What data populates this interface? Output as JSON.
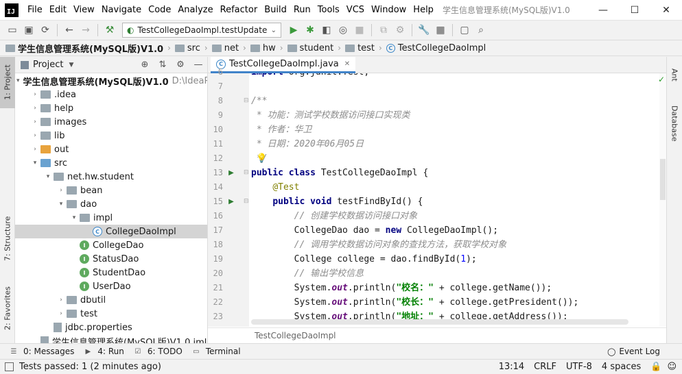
{
  "app": {
    "logo_text": "IJ",
    "window_title": "学生信息管理系统(MySQL版)V1.0"
  },
  "menu": [
    "File",
    "Edit",
    "View",
    "Navigate",
    "Code",
    "Analyze",
    "Refactor",
    "Build",
    "Run",
    "Tools",
    "VCS",
    "Window",
    "Help"
  ],
  "window_controls": {
    "minimize": "—",
    "maximize": "☐",
    "close": "✕"
  },
  "toolbar": {
    "run_config": "TestCollegeDaoImpl.testUpdate"
  },
  "breadcrumb": [
    "学生信息管理系统(MySQL版)V1.0",
    "src",
    "net",
    "hw",
    "student",
    "test",
    "TestCollegeDaoImpl"
  ],
  "left_stripe": {
    "project": "1: Project",
    "structure": "7: Structure",
    "favorites": "2: Favorites"
  },
  "right_stripe": {
    "ant": "Ant",
    "database": "Database"
  },
  "project_panel": {
    "title": "Project",
    "tree": [
      {
        "label": "学生信息管理系统(MySQL版)V1.0",
        "hint": "D:\\IdeaP",
        "icon": "folder-blue",
        "depth": 0,
        "expand": "open",
        "bold": true
      },
      {
        "label": ".idea",
        "icon": "folder",
        "depth": 1,
        "expand": "closed"
      },
      {
        "label": "help",
        "icon": "folder",
        "depth": 1,
        "expand": "closed"
      },
      {
        "label": "images",
        "icon": "folder",
        "depth": 1,
        "expand": "closed"
      },
      {
        "label": "lib",
        "icon": "folder",
        "depth": 1,
        "expand": "closed"
      },
      {
        "label": "out",
        "icon": "folder-orange",
        "depth": 1,
        "expand": "closed"
      },
      {
        "label": "src",
        "icon": "folder-blue",
        "depth": 1,
        "expand": "open"
      },
      {
        "label": "net.hw.student",
        "icon": "package",
        "depth": 2,
        "expand": "open"
      },
      {
        "label": "bean",
        "icon": "package",
        "depth": 3,
        "expand": "closed"
      },
      {
        "label": "dao",
        "icon": "package",
        "depth": 3,
        "expand": "open"
      },
      {
        "label": "impl",
        "icon": "package",
        "depth": 4,
        "expand": "open"
      },
      {
        "label": "CollegeDaoImpl",
        "icon": "class",
        "depth": 5,
        "expand": "none",
        "selected": true
      },
      {
        "label": "CollegeDao",
        "icon": "interface",
        "depth": 4,
        "expand": "none"
      },
      {
        "label": "StatusDao",
        "icon": "interface",
        "depth": 4,
        "expand": "none"
      },
      {
        "label": "StudentDao",
        "icon": "interface",
        "depth": 4,
        "expand": "none"
      },
      {
        "label": "UserDao",
        "icon": "interface",
        "depth": 4,
        "expand": "none"
      },
      {
        "label": "dbutil",
        "icon": "package",
        "depth": 3,
        "expand": "closed"
      },
      {
        "label": "test",
        "icon": "package",
        "depth": 3,
        "expand": "closed"
      },
      {
        "label": "jdbc.properties",
        "icon": "file",
        "depth": 2,
        "expand": "none"
      },
      {
        "label": "学生信息管理系统(MySQL版)V1.0.iml",
        "icon": "file",
        "depth": 1,
        "expand": "none"
      }
    ]
  },
  "editor": {
    "tab": "TestCollegeDaoImpl.java",
    "footer_breadcrumb": "TestCollegeDaoImpl",
    "lines": [
      {
        "n": "6",
        "tokens": [
          [
            "kw",
            "import"
          ],
          [
            "",
            " org.junit.Test;"
          ]
        ]
      },
      {
        "n": "7",
        "tokens": []
      },
      {
        "n": "8",
        "tokens": [
          [
            "cm",
            "/**"
          ]
        ]
      },
      {
        "n": "9",
        "tokens": [
          [
            "cm",
            " * 功能：测试学校数据访问接口实现类"
          ]
        ]
      },
      {
        "n": "10",
        "tokens": [
          [
            "cm",
            " * 作者：华卫"
          ]
        ]
      },
      {
        "n": "11",
        "tokens": [
          [
            "cm",
            " * 日期：2020年06月05日"
          ]
        ]
      },
      {
        "n": "12",
        "tokens": [
          [
            "cm",
            " */"
          ]
        ]
      },
      {
        "n": "13",
        "tokens": [
          [
            "kw",
            "public class"
          ],
          [
            "",
            " TestCollegeDaoImpl {"
          ]
        ]
      },
      {
        "n": "14",
        "tokens": [
          [
            "",
            "    "
          ],
          [
            "ann",
            "@Test"
          ]
        ]
      },
      {
        "n": "15",
        "tokens": [
          [
            "",
            "    "
          ],
          [
            "kw",
            "public void"
          ],
          [
            "",
            " testFindById() {"
          ]
        ]
      },
      {
        "n": "16",
        "tokens": [
          [
            "",
            "        "
          ],
          [
            "cm",
            "// 创建学校数据访问接口对象"
          ]
        ]
      },
      {
        "n": "17",
        "tokens": [
          [
            "",
            "        CollegeDao dao = "
          ],
          [
            "kw",
            "new"
          ],
          [
            "",
            " CollegeDaoImpl();"
          ]
        ]
      },
      {
        "n": "18",
        "tokens": [
          [
            "",
            "        "
          ],
          [
            "cm",
            "// 调用学校数据访问对象的查找方法，获取学校对象"
          ]
        ]
      },
      {
        "n": "19",
        "tokens": [
          [
            "",
            "        College college = dao.findById("
          ],
          [
            "num",
            "1"
          ],
          [
            "",
            ");"
          ]
        ]
      },
      {
        "n": "20",
        "tokens": [
          [
            "",
            "        "
          ],
          [
            "cm",
            "// 输出学校信息"
          ]
        ]
      },
      {
        "n": "21",
        "tokens": [
          [
            "",
            "        System."
          ],
          [
            "fld",
            "out"
          ],
          [
            "",
            ".println("
          ],
          [
            "st",
            "\"校名：\""
          ],
          [
            "",
            " + college.getName());"
          ]
        ]
      },
      {
        "n": "22",
        "tokens": [
          [
            "",
            "        System."
          ],
          [
            "fld",
            "out"
          ],
          [
            "",
            ".println("
          ],
          [
            "st",
            "\"校长：\""
          ],
          [
            "",
            " + college.getPresident());"
          ]
        ]
      },
      {
        "n": "23",
        "tokens": [
          [
            "",
            "        System."
          ],
          [
            "fld",
            "out"
          ],
          [
            "",
            ".println("
          ],
          [
            "st",
            "\"地址：\""
          ],
          [
            "",
            " + college.getAddress());"
          ]
        ]
      }
    ]
  },
  "bottom_tools": [
    {
      "label": "0: Messages",
      "icon": "messages-icon"
    },
    {
      "label": "4: Run",
      "icon": "run-icon"
    },
    {
      "label": "6: TODO",
      "icon": "todo-icon"
    },
    {
      "label": "Terminal",
      "icon": "terminal-icon"
    }
  ],
  "event_log": "Event Log",
  "status": {
    "message": "Tests passed: 1 (2 minutes ago)",
    "position": "13:14",
    "line_sep": "CRLF",
    "encoding": "UTF-8",
    "indent": "4 spaces"
  }
}
